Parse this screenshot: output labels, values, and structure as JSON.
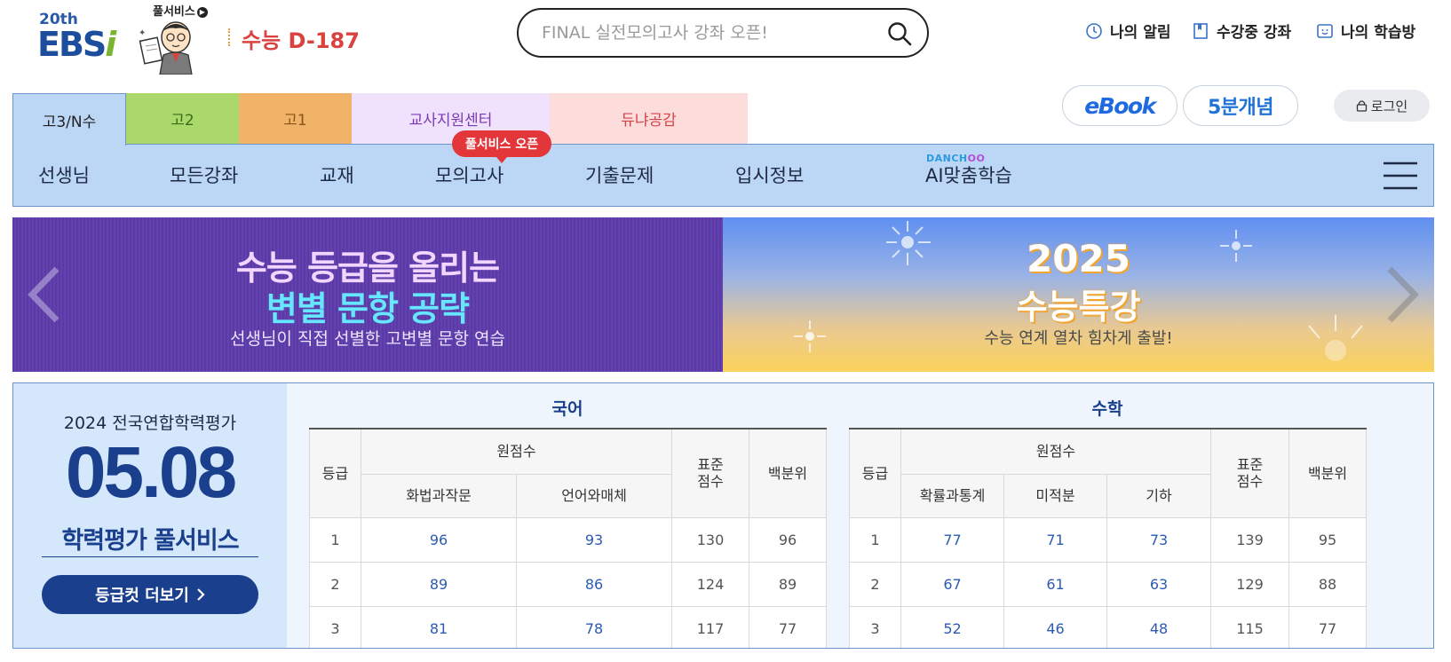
{
  "header": {
    "logo_anniversary": "20th",
    "logo_text": "EBS",
    "logo_text_i": "i",
    "logo_badge": "풀서비스",
    "dday": "수능 D-187",
    "search_placeholder": "FINAL 실전모의고사 강좌 오픈!",
    "links": [
      {
        "label": "나의 알림",
        "icon": "clock-icon"
      },
      {
        "label": "수강중 강좌",
        "icon": "bookmark-icon"
      },
      {
        "label": "나의 학습방",
        "icon": "smile-icon"
      }
    ]
  },
  "tabs": [
    {
      "label": "고3/N수",
      "active": true
    },
    {
      "label": "고2"
    },
    {
      "label": "고1"
    },
    {
      "label": "교사지원센터"
    },
    {
      "label": "듀냐공감"
    }
  ],
  "top_buttons": {
    "ebook": "eBook",
    "concept": "5분개념",
    "login": "로그인"
  },
  "nav": {
    "items": [
      "선생님",
      "모든강좌",
      "교재",
      "모의고사",
      "기출문제",
      "입시정보",
      "AI맞춤학습"
    ],
    "badge": "풀서비스 오픈",
    "ai_brand_a": "DANCH",
    "ai_brand_b": "OO"
  },
  "banner": {
    "left_title_1": "수능 등급을 올리는",
    "left_title_2": "변별 문항 공략",
    "left_sub": "선생님이 직접 선별한 고변별 문항 연습",
    "right_title_1": "2025",
    "right_title_2": "수능특강",
    "right_sub": "수능 연계 열차 힘차게 출발!"
  },
  "panel": {
    "subtitle": "2024 전국연합학력평가",
    "date": "05.08",
    "title": "학력평가 풀서비스",
    "button": "등급컷 더보기"
  },
  "korean": {
    "subject": "국어",
    "h_grade": "등급",
    "h_raw": "원점수",
    "h_std": "표준 점수",
    "h_pct": "백분위",
    "subcols": [
      "화법과작문",
      "언어와매체"
    ],
    "rows": [
      {
        "grade": "1",
        "raw": [
          "96",
          "93"
        ],
        "std": "130",
        "pct": "96"
      },
      {
        "grade": "2",
        "raw": [
          "89",
          "86"
        ],
        "std": "124",
        "pct": "89"
      },
      {
        "grade": "3",
        "raw": [
          "81",
          "78"
        ],
        "std": "117",
        "pct": "77"
      }
    ]
  },
  "math": {
    "subject": "수학",
    "h_grade": "등급",
    "h_raw": "원점수",
    "h_std": "표준 점수",
    "h_pct": "백분위",
    "subcols": [
      "확률과통계",
      "미적분",
      "기하"
    ],
    "rows": [
      {
        "grade": "1",
        "raw": [
          "77",
          "71",
          "73"
        ],
        "std": "139",
        "pct": "95"
      },
      {
        "grade": "2",
        "raw": [
          "67",
          "61",
          "63"
        ],
        "std": "129",
        "pct": "88"
      },
      {
        "grade": "3",
        "raw": [
          "52",
          "46",
          "48"
        ],
        "std": "115",
        "pct": "77"
      }
    ]
  }
}
